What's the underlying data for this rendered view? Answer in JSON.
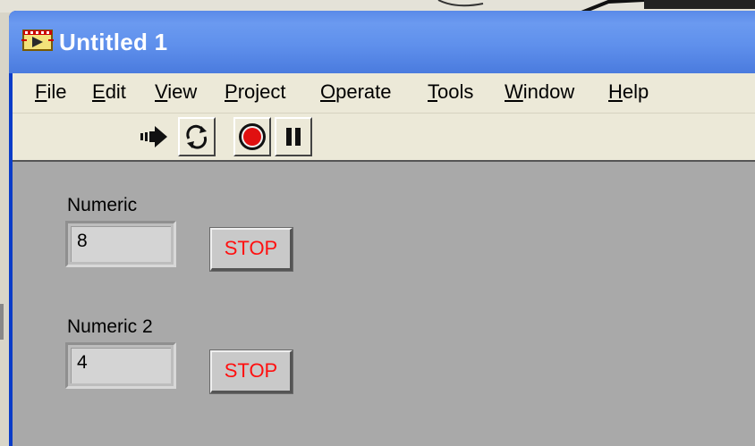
{
  "window": {
    "title": "Untitled 1",
    "title_icon": "labview-vi-icon"
  },
  "menu": {
    "items": [
      {
        "label": "File",
        "underline": "F",
        "rest": "ile"
      },
      {
        "label": "Edit",
        "underline": "E",
        "rest": "dit"
      },
      {
        "label": "View",
        "underline": "V",
        "rest": "iew"
      },
      {
        "label": "Project",
        "underline": "P",
        "rest": "roject"
      },
      {
        "label": "Operate",
        "underline": "O",
        "rest": "perate"
      },
      {
        "label": "Tools",
        "underline": "T",
        "rest": "ools"
      },
      {
        "label": "Window",
        "underline": "W",
        "rest": "indow"
      },
      {
        "label": "Help",
        "underline": "H",
        "rest": "elp"
      }
    ]
  },
  "toolbar": {
    "buttons": [
      {
        "name": "run-arrow-icon"
      },
      {
        "name": "run-continuously-icon"
      },
      {
        "name": "abort-execution-icon"
      },
      {
        "name": "pause-icon"
      }
    ]
  },
  "controls": {
    "numeric_1": {
      "label": "Numeric",
      "value": "8"
    },
    "stop_1": {
      "label": "STOP"
    },
    "numeric_2": {
      "label": "Numeric 2",
      "value": "4"
    },
    "stop_2": {
      "label": "STOP"
    }
  },
  "colors": {
    "titlebar": "#5f90ec",
    "menubar": "#ece9d8",
    "panel": "#a9a9a9",
    "stop_text": "#ff1010"
  }
}
